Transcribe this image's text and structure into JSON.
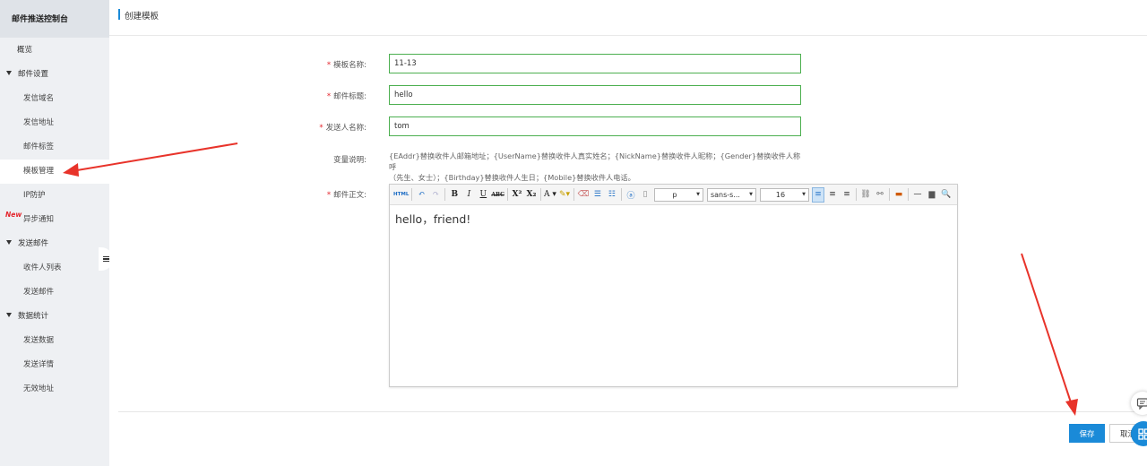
{
  "sidebar": {
    "title": "邮件推送控制台",
    "overview": "概览",
    "groups": [
      {
        "label": "邮件设置",
        "items": [
          "发信域名",
          "发信地址",
          "邮件标签",
          "模板管理",
          "IP防护",
          "异步通知"
        ]
      },
      {
        "label": "发送邮件",
        "items": [
          "收件人列表",
          "发送邮件"
        ]
      },
      {
        "label": "数据统计",
        "items": [
          "发送数据",
          "发送详情",
          "无效地址"
        ]
      }
    ],
    "active_item": "模板管理",
    "new_badge": "New"
  },
  "header": {
    "title": "创建模板"
  },
  "form": {
    "template_name": {
      "label": "模板名称:",
      "value": "11-13"
    },
    "subject": {
      "label": "邮件标题:",
      "value": "hello"
    },
    "sender_name": {
      "label": "发送人名称:",
      "value": "tom"
    },
    "variables": {
      "label": "变量说明:",
      "line1": "{EAddr}替换收件人邮箱地址；{UserName}替换收件人真实姓名；{NickName}替换收件人昵称；{Gender}替换收件人称呼",
      "line2": "（先生、女士）；{Birthday}替换收件人生日；{Mobile}替换收件人电话。"
    },
    "body": {
      "label": "邮件正文:",
      "content": "hello，friend!",
      "toolbar": {
        "format": "p",
        "font": "sans-s...",
        "size": "16"
      }
    }
  },
  "footer": {
    "save": "保存",
    "cancel": "取消"
  },
  "colors": {
    "accent": "#1a8ad8",
    "required": "#e4262d",
    "input_border": "#4caf50",
    "annotation": "#e8332a"
  }
}
